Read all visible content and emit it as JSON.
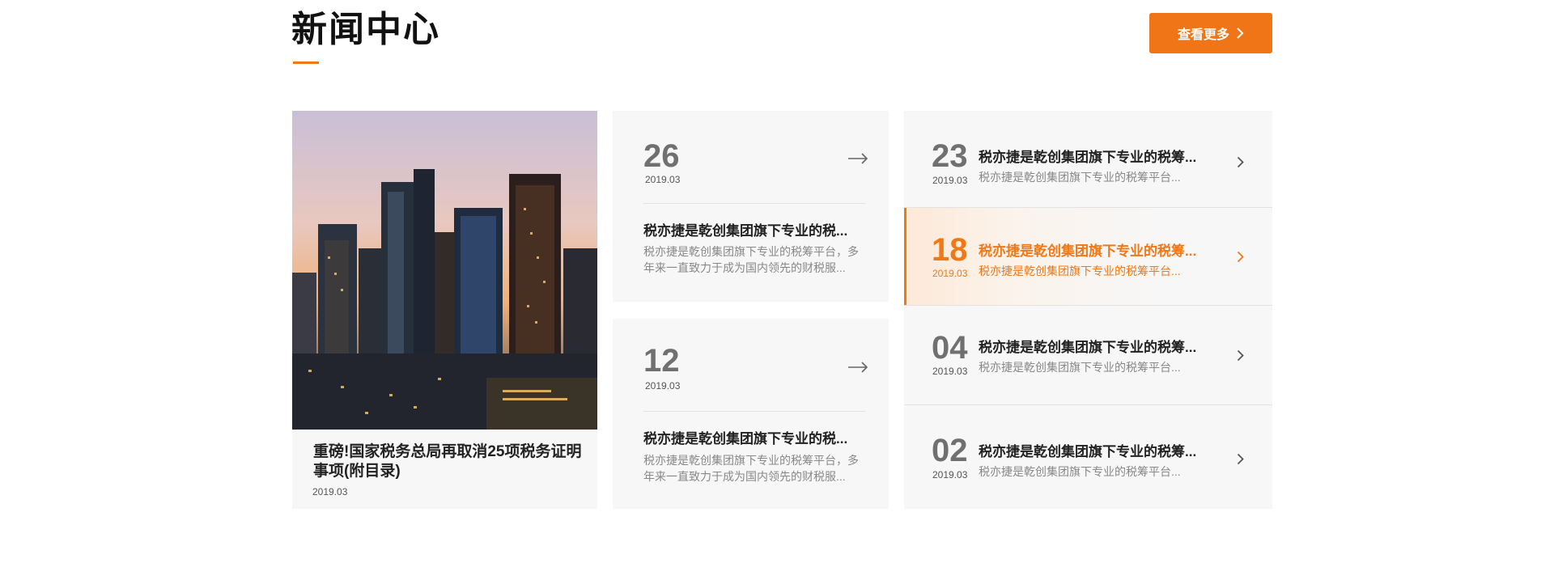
{
  "section": {
    "title": "新闻中心"
  },
  "more_button": {
    "label": "查看更多"
  },
  "featured": {
    "title": "重磅!国家税务总局再取消25项税务证明事项(附目录)",
    "date": "2019.03"
  },
  "mid_cards": [
    {
      "day": "26",
      "ym": "2019.03",
      "title": "税亦捷是乾创集团旗下专业的税...",
      "desc": "税亦捷是乾创集团旗下专业的税筹平台，多年来一直致力于成为国内领先的财税服..."
    },
    {
      "day": "12",
      "ym": "2019.03",
      "title": "税亦捷是乾创集团旗下专业的税...",
      "desc": "税亦捷是乾创集团旗下专业的税筹平台，多年来一直致力于成为国内领先的财税服..."
    }
  ],
  "list": [
    {
      "day": "23",
      "ym": "2019.03",
      "title": "税亦捷是乾创集团旗下专业的税筹...",
      "desc": "税亦捷是乾创集团旗下专业的税筹平台..."
    },
    {
      "day": "18",
      "ym": "2019.03",
      "title": "税亦捷是乾创集团旗下专业的税筹...",
      "desc": "税亦捷是乾创集团旗下专业的税筹平台...",
      "active": true
    },
    {
      "day": "04",
      "ym": "2019.03",
      "title": "税亦捷是乾创集团旗下专业的税筹...",
      "desc": "税亦捷是乾创集团旗下专业的税筹平台..."
    },
    {
      "day": "02",
      "ym": "2019.03",
      "title": "税亦捷是乾创集团旗下专业的税筹...",
      "desc": "税亦捷是乾创集团旗下专业的税筹平台..."
    }
  ],
  "icons": {
    "more": "chevron-right-icon",
    "card_arrow": "arrow-right-icon",
    "list_chevron": "chevron-right-icon"
  },
  "colors": {
    "accent": "#f07817",
    "card_bg": "#f7f7f7",
    "text_muted": "#888888",
    "number": "#707070"
  }
}
